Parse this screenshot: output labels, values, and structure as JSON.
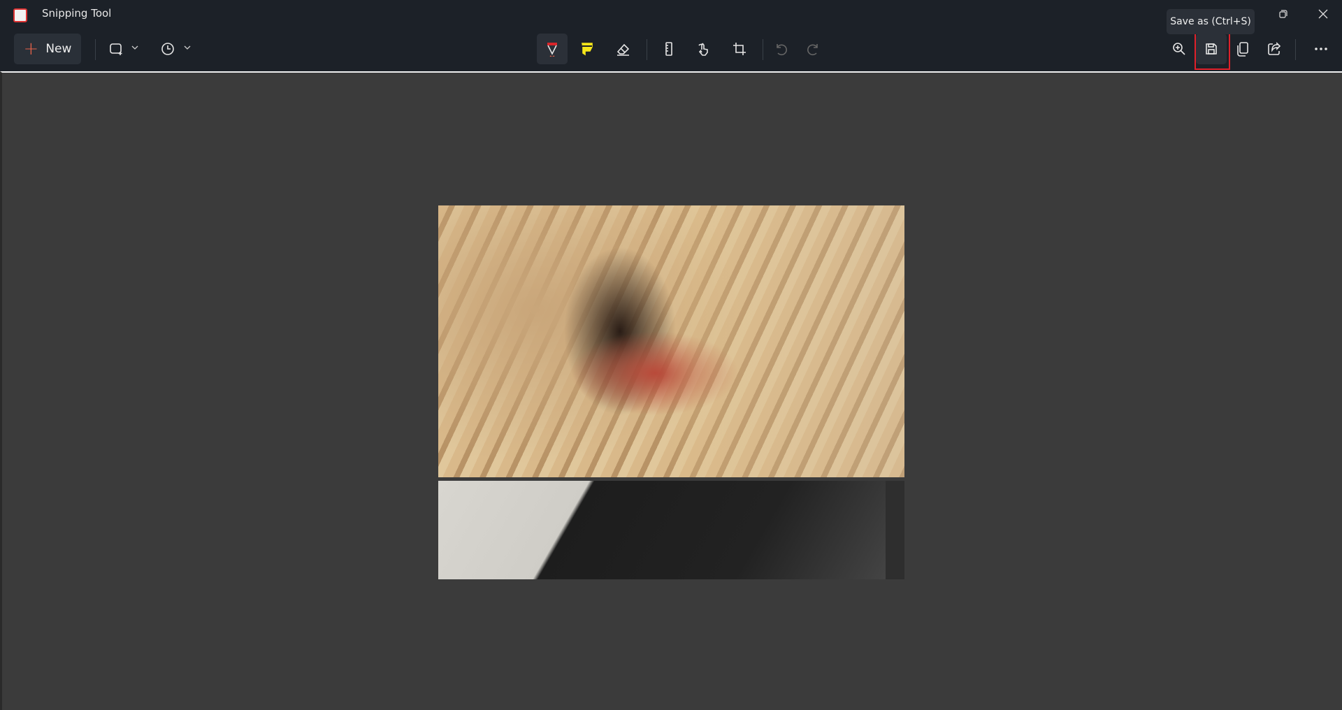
{
  "window": {
    "title": "Snipping Tool",
    "app_icon": "snipping-tool-icon"
  },
  "toolbar": {
    "new_label": "New",
    "left_tools": [
      {
        "name": "snip-mode",
        "icon": "rectangle-snip-icon"
      },
      {
        "name": "delay",
        "icon": "clock-icon"
      }
    ],
    "center_tools": [
      "ballpoint-pen-icon",
      "highlighter-icon",
      "eraser-icon",
      "ruler-icon",
      "touch-writing-icon",
      "crop-icon",
      "undo-icon",
      "redo-icon"
    ],
    "right_tools": [
      "zoom-in-icon",
      "save-icon",
      "copy-icon",
      "share-icon",
      "more-icon"
    ],
    "pen_color": "#d9252a",
    "highlighter_color": "#f5e61a"
  },
  "tooltip": {
    "text": "Save as (Ctrl+S)"
  },
  "highlight_color": "#e0202a"
}
